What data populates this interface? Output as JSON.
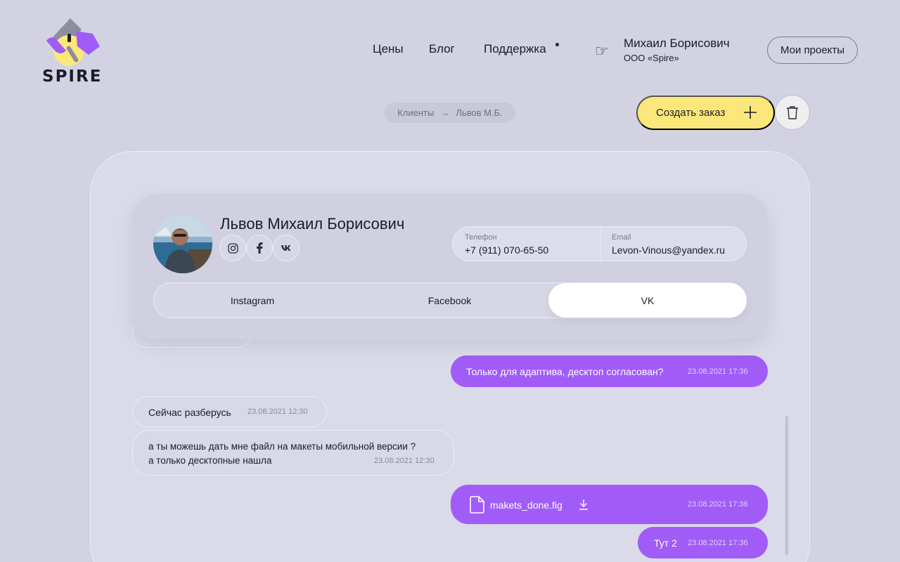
{
  "brand": {
    "name": "SPIRE"
  },
  "nav": {
    "prices": "Цены",
    "blog": "Блог",
    "support": "Поддержка"
  },
  "user": {
    "name": "Михаил Борисович",
    "org": "ООО «Spire»",
    "icon": "pointing-hand-icon"
  },
  "header": {
    "projects_button": "Мои проекты"
  },
  "breadcrumb": {
    "root": "Клиенты",
    "arrow": "→",
    "current": "Львов М.Б."
  },
  "actions": {
    "create_order": "Создать заказ"
  },
  "client": {
    "name": "Львов Михаил Борисович",
    "socials": [
      "instagram-icon",
      "facebook-icon",
      "vk-icon"
    ],
    "phone_label": "Телефон",
    "phone": "+7 (911) 070-65-50",
    "email_label": "Email",
    "email": "Levon-Vinous@yandex.ru"
  },
  "tabs": [
    {
      "label": "Instagram",
      "active": false
    },
    {
      "label": "Facebook",
      "active": false
    },
    {
      "label": "VK",
      "active": true
    }
  ],
  "messages": [
    {
      "dir": "out",
      "text": "Только для адаптива, десктоп согласован?",
      "time": "23.08.2021 17:36"
    },
    {
      "dir": "in",
      "text": "Сейчас разберусь",
      "time": "23.08.2021 12:30"
    },
    {
      "dir": "in",
      "line1": "а ты можешь дать мне файл на макеты мобильной версии ?",
      "line2": "а только десктопные нашла",
      "time": "23.08.2021 12:30"
    },
    {
      "dir": "out",
      "file": "makets_done.fig",
      "time": "23.08.2021 17:36"
    },
    {
      "dir": "out",
      "text": "Тут 2",
      "time": "23.08.2021 17:36"
    }
  ],
  "colors": {
    "background": "#d2d2e2",
    "accent": "#a15cf8",
    "create": "#fce77a",
    "tab_active": "#ffffff"
  }
}
